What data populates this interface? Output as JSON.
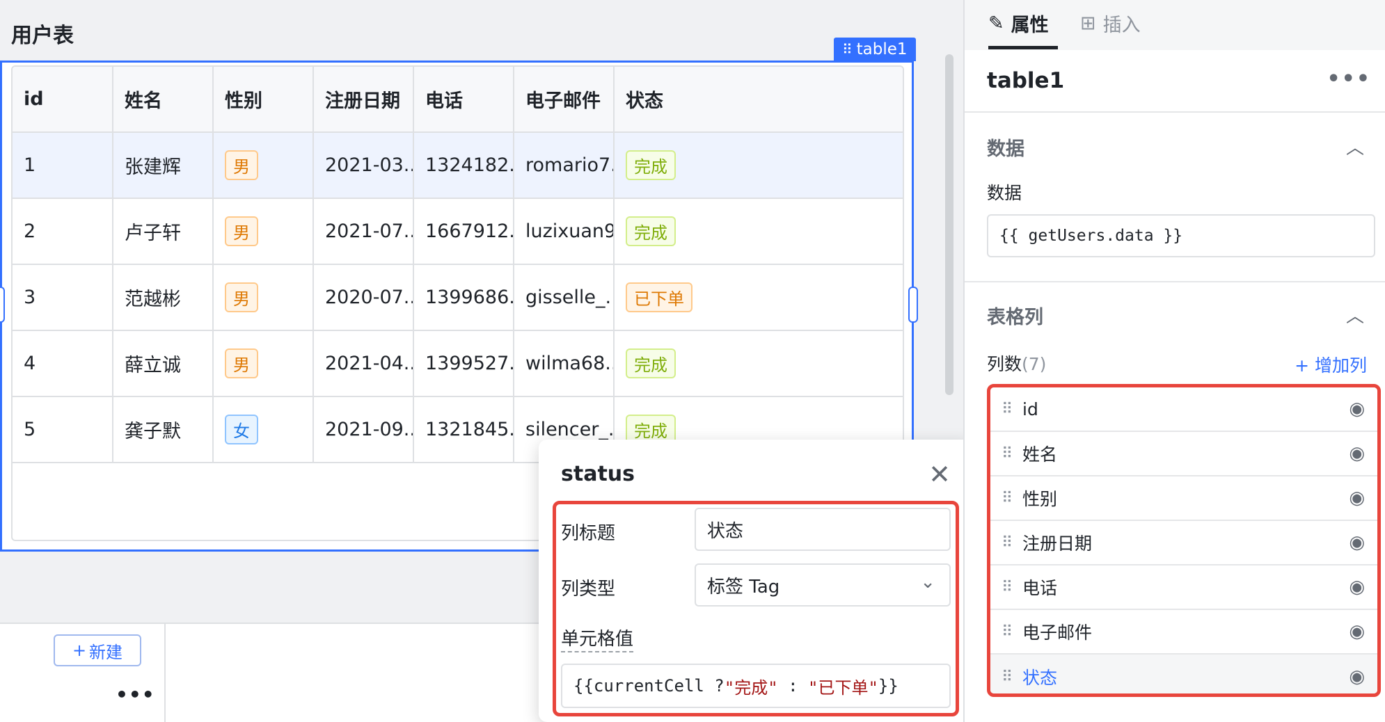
{
  "page": {
    "title": "用户表"
  },
  "component": {
    "label": "table1"
  },
  "table": {
    "columns": [
      "id",
      "姓名",
      "性别",
      "注册日期",
      "电话",
      "电子邮件",
      "状态"
    ],
    "rows": [
      {
        "id": "1",
        "name": "张建辉",
        "gender": "男",
        "date": "2021-03...",
        "phone": "1324182...",
        "email": "romario7...",
        "status": "完成"
      },
      {
        "id": "2",
        "name": "卢子轩",
        "gender": "男",
        "date": "2021-07...",
        "phone": "1667912...",
        "email": "luzixuan9...",
        "status": "完成"
      },
      {
        "id": "3",
        "name": "范越彬",
        "gender": "男",
        "date": "2020-07...",
        "phone": "1399686...",
        "email": "gisselle_...",
        "status": "已下单"
      },
      {
        "id": "4",
        "name": "薛立诚",
        "gender": "男",
        "date": "2021-04...",
        "phone": "1399527...",
        "email": "wilma68...",
        "status": "完成"
      },
      {
        "id": "5",
        "name": "龚子默",
        "gender": "女",
        "date": "2021-09...",
        "phone": "1321845...",
        "email": "silencer_...",
        "status": "完成"
      }
    ],
    "toolbar": {
      "refresh_icon": "refresh-icon",
      "filter_icon": "filter-icon",
      "download_icon": "download-icon"
    }
  },
  "bottom": {
    "new_label": "新建",
    "new_plus": "+",
    "more": "•••"
  },
  "popover": {
    "title": "status",
    "close": "✕",
    "col_title_label": "列标题",
    "col_title_value": "状态",
    "col_type_label": "列类型",
    "col_type_value": "标签 Tag",
    "cell_value_label": "单元格值",
    "cell_value_pre": "{{currentCell ? ",
    "cell_value_str1": "\"完成\"",
    "cell_value_mid": " : ",
    "cell_value_str2": "\"已下单\"",
    "cell_value_post": "}}"
  },
  "right_panel": {
    "tab_props": "属性",
    "tab_insert": "插入",
    "component_name": "table1",
    "more": "•••",
    "section_data": "数据",
    "data_label": "数据",
    "data_value": "{{ getUsers.data }}",
    "section_columns": "表格列",
    "col_count_label": "列数",
    "col_count": "(7)",
    "add_col": "+ 增加列",
    "column_items": [
      "id",
      "姓名",
      "性别",
      "注册日期",
      "电话",
      "电子邮件",
      "状态"
    ]
  },
  "colors": {
    "accent": "#3370ff",
    "highlight": "#e8453c"
  }
}
